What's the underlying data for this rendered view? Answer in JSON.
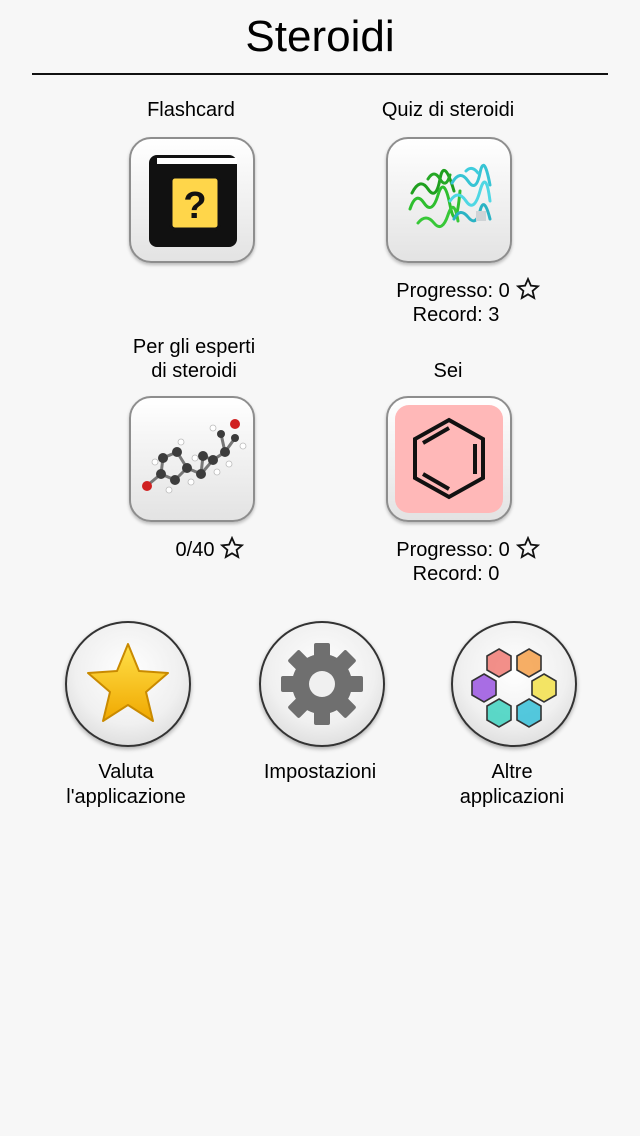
{
  "header": {
    "title": "Steroidi"
  },
  "modes": {
    "flashcard": {
      "label": "Flashcard"
    },
    "quiz": {
      "label": "Quiz di steroidi",
      "progress": "Progresso: 0",
      "record": "Record: 3"
    },
    "experts": {
      "label_line1": "Per gli esperti",
      "label_line2": "di steroidi",
      "score": "0/40"
    },
    "sei": {
      "label": "Sei",
      "progress": "Progresso: 0",
      "record": "Record: 0"
    }
  },
  "actions": {
    "rate": {
      "line1": "Valuta",
      "line2": "l'applicazione"
    },
    "settings": {
      "line1": "Impostazioni"
    },
    "more": {
      "line1": "Altre",
      "line2": "applicazioni"
    }
  },
  "icons": {
    "flashcard": "book-question-icon",
    "quiz": "protein-structure-icon",
    "experts": "steroid-molecule-icon",
    "sei": "benzene-ring-icon",
    "rate": "star-icon",
    "settings": "gear-icon",
    "more": "hexagon-cluster-icon",
    "progress_star": "star-outline-icon"
  },
  "colors": {
    "book": "#111111",
    "book_label": "#ffd64a",
    "benzene_bg": "#ffb8b8",
    "rate_star": "#ffc400"
  }
}
